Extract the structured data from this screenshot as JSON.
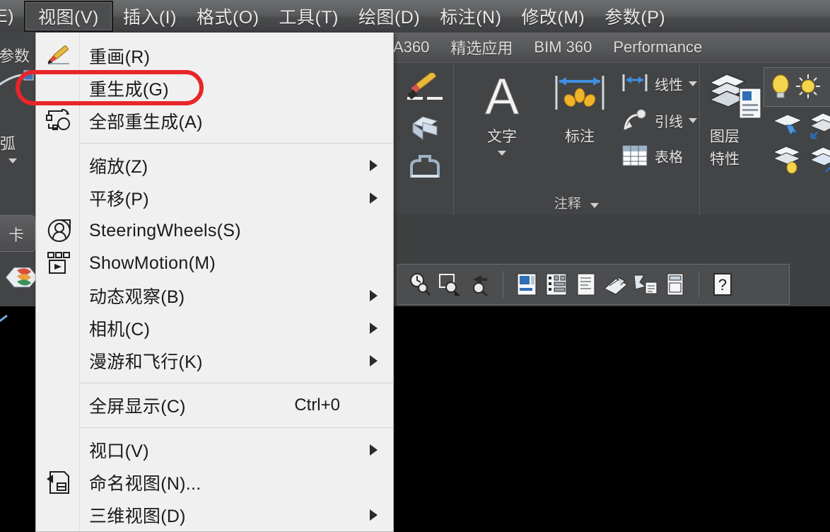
{
  "app": {
    "menubar": [
      {
        "label": "E)",
        "active": false,
        "clipped": true
      },
      {
        "label": "视图(V)",
        "active": true
      },
      {
        "label": "插入(I)",
        "active": false
      },
      {
        "label": "格式(O)",
        "active": false
      },
      {
        "label": "工具(T)",
        "active": false
      },
      {
        "label": "绘图(D)",
        "active": false
      },
      {
        "label": "标注(N)",
        "active": false
      },
      {
        "label": "修改(M)",
        "active": false
      },
      {
        "label": "参数(P)",
        "active": false
      }
    ],
    "ribbon_tabs": [
      {
        "label": "A360"
      },
      {
        "label": "精选应用"
      },
      {
        "label": "BIM 360"
      },
      {
        "label": "Performance"
      }
    ],
    "panels": {
      "draw": {
        "title": ""
      },
      "annotation": {
        "title": "注释",
        "text_label": "文字",
        "dimension_label": "标注",
        "linear_label": "线性",
        "leader_label": "引线",
        "table_label": "表格"
      },
      "layers": {
        "title": "",
        "layer_label": "图层",
        "properties_label": "特性"
      }
    },
    "left_strip": {
      "param_label": "参数",
      "arc_label": "弧",
      "card_label": "卡"
    }
  },
  "menu": {
    "title": "视图(V)",
    "items": [
      {
        "type": "item",
        "label": "重画(R)",
        "icon": "redraw-icon",
        "shortcut": "",
        "submenu": false,
        "highlighted": false
      },
      {
        "type": "item",
        "label": "重生成(G)",
        "icon": "",
        "shortcut": "",
        "submenu": false,
        "highlighted": true
      },
      {
        "type": "item",
        "label": "全部重生成(A)",
        "icon": "regen-all-icon",
        "shortcut": "",
        "submenu": false,
        "highlighted": false
      },
      {
        "type": "separator"
      },
      {
        "type": "item",
        "label": "缩放(Z)",
        "icon": "",
        "shortcut": "",
        "submenu": true,
        "highlighted": false
      },
      {
        "type": "item",
        "label": "平移(P)",
        "icon": "",
        "shortcut": "",
        "submenu": true,
        "highlighted": false
      },
      {
        "type": "item",
        "label": "SteeringWheels(S)",
        "icon": "steeringwheel-icon",
        "shortcut": "",
        "submenu": false,
        "highlighted": false
      },
      {
        "type": "item",
        "label": "ShowMotion(M)",
        "icon": "showmotion-icon",
        "shortcut": "",
        "submenu": false,
        "highlighted": false
      },
      {
        "type": "item",
        "label": "动态观察(B)",
        "icon": "",
        "shortcut": "",
        "submenu": true,
        "highlighted": false
      },
      {
        "type": "item",
        "label": "相机(C)",
        "icon": "",
        "shortcut": "",
        "submenu": true,
        "highlighted": false
      },
      {
        "type": "item",
        "label": "漫游和飞行(K)",
        "icon": "",
        "shortcut": "",
        "submenu": true,
        "highlighted": false
      },
      {
        "type": "separator"
      },
      {
        "type": "item",
        "label": "全屏显示(C)",
        "icon": "",
        "shortcut": "Ctrl+0",
        "submenu": false,
        "highlighted": false
      },
      {
        "type": "separator"
      },
      {
        "type": "item",
        "label": "视口(V)",
        "icon": "",
        "shortcut": "",
        "submenu": true,
        "highlighted": false
      },
      {
        "type": "item",
        "label": "命名视图(N)...",
        "icon": "named-view-icon",
        "shortcut": "",
        "submenu": false,
        "highlighted": false
      },
      {
        "type": "item",
        "label": "三维视图(D)",
        "icon": "",
        "shortcut": "",
        "submenu": true,
        "highlighted": false
      }
    ]
  },
  "toolbar": {
    "icons": [
      {
        "name": "zoom-previous-icon"
      },
      {
        "name": "zoom-window-icon"
      },
      {
        "name": "pan-realtime-icon"
      },
      {
        "name": "properties-icon"
      },
      {
        "name": "design-center-icon"
      },
      {
        "name": "tool-palettes-icon"
      },
      {
        "name": "sheet-set-manager-icon"
      },
      {
        "name": "markup-set-manager-icon"
      },
      {
        "name": "quick-calc-icon"
      },
      {
        "name": "help-icon"
      }
    ],
    "help_label": "?"
  },
  "colors": {
    "accent_red": "#e8262a",
    "menu_bg": "#f0f0f0",
    "chrome_bg": "#434446",
    "canvas_bg": "#000000",
    "text_light": "#e3e3e4",
    "text_dark": "#1a1a1a"
  }
}
